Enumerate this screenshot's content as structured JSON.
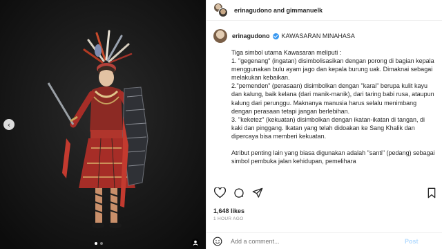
{
  "header": {
    "title": "erinagudono and gimmanuelk"
  },
  "post": {
    "username": "erinagudono",
    "headline": "KAWASARAN MINAHASA",
    "caption": "Tiga simbol utama Kawasaran meliputi :\n1. \"gegenang\" (ingatan) disimbolisasikan dengan porong di bagian kepala menggunakan bulu ayam jago dan kepala burung uak. Dimaknai sebagai melakukan kebaikan.\n2.\"pemenden\" (perasaan) disimbolkan dengan \"karai\" berupa kulit kayu dan kalung, baik kelana (dari manik-manik), dari taring babi rusa, ataupun kalung dari perunggu. Maknanya manusia harus selalu menimbang dengan perasaan tetapi jangan berlebihan.\n3. \"keketez\" (kekuatan) disimbolkan dengan ikatan-ikatan di tangan, di kaki dan pinggang. Ikatan yang telah didoakan ke Sang Khalik dan dipercaya bisa memberi kekuatan.\n\nAtribut penting lain yang biasa digunakan adalah \"santi\" (pedang) sebagai simbol pembuka jalan kehidupan, pemelihara"
  },
  "stats": {
    "likes": "1,648 likes",
    "time": "1 HOUR AGO"
  },
  "comment": {
    "placeholder": "Add a comment...",
    "post_label": "Post"
  },
  "icons": {
    "heart": "heart-icon",
    "comment": "comment-icon",
    "share": "share-icon",
    "save": "bookmark-icon",
    "emoji": "emoji-icon",
    "nav": "chevron-left-icon",
    "tag": "user-tag-icon"
  },
  "carousel": {
    "count": 2,
    "active": 1
  },
  "colors": {
    "verified": "#3897f0",
    "post_button": "#b3dbff",
    "muted": "#8e8e8e"
  }
}
